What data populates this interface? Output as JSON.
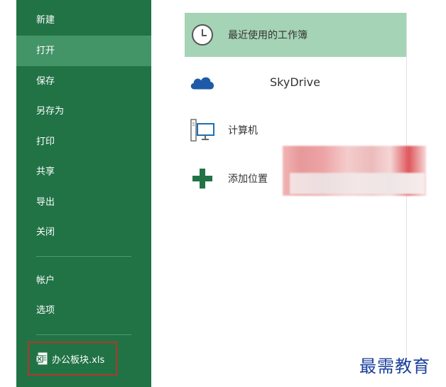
{
  "sidebar": {
    "items": [
      {
        "label": "新建"
      },
      {
        "label": "打开",
        "active": true
      },
      {
        "label": "保存"
      },
      {
        "label": "另存为"
      },
      {
        "label": "打印"
      },
      {
        "label": "共享"
      },
      {
        "label": "导出"
      },
      {
        "label": "关闭"
      },
      {
        "label": "帐户"
      },
      {
        "label": "选项"
      }
    ],
    "recent_file": "办公板块.xls"
  },
  "locations": {
    "items": [
      {
        "label": "最近使用的工作簿",
        "icon": "clock-icon",
        "selected": true
      },
      {
        "label": "SkyDrive",
        "icon": "cloud-icon"
      },
      {
        "label": "计算机",
        "icon": "computer-icon"
      },
      {
        "label": "添加位置",
        "icon": "plus-icon"
      }
    ]
  },
  "watermark": "最需教育",
  "colors": {
    "sidebar": "#217346",
    "sidebar_active": "#439467",
    "selected_location": "#a5d3b5",
    "highlight_border": "#b1372b",
    "watermark": "#1a3f9c"
  }
}
